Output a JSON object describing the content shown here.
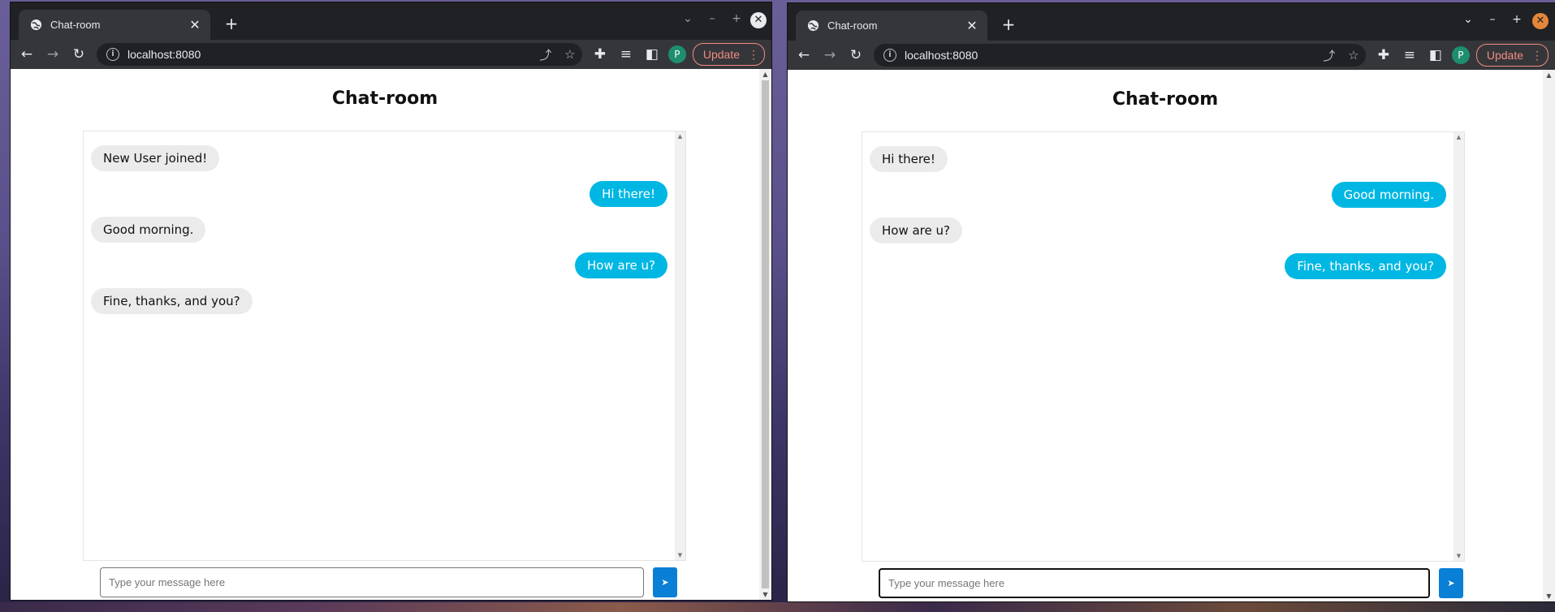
{
  "colors": {
    "sent_bubble": "#00b7e3",
    "received_bubble": "#ebebeb",
    "send_button": "#0a7fd6",
    "update_accent": "#f28b82",
    "profile": "#1e8e6e"
  },
  "icons": [
    "globe-icon",
    "close-icon",
    "plus-icon",
    "chevron-down-icon",
    "back-icon",
    "forward-icon",
    "reload-icon",
    "info-icon",
    "share-icon",
    "star-icon",
    "extensions-icon",
    "media-icon",
    "side-panel-icon",
    "send-icon"
  ],
  "left": {
    "tab_title": "Chat-room",
    "url": "localhost:8080",
    "profile_initial": "P",
    "update_label": "Update",
    "heading": "Chat-room",
    "input_placeholder": "Type your message here",
    "send_glyph": "➤",
    "messages": [
      {
        "direction": "in",
        "text": "New User joined!"
      },
      {
        "direction": "out",
        "text": "Hi there!"
      },
      {
        "direction": "in",
        "text": "Good morning."
      },
      {
        "direction": "out",
        "text": "How are u?"
      },
      {
        "direction": "in",
        "text": "Fine, thanks, and you?"
      }
    ]
  },
  "right": {
    "tab_title": "Chat-room",
    "url": "localhost:8080",
    "profile_initial": "P",
    "update_label": "Update",
    "heading": "Chat-room",
    "input_placeholder": "Type your message here",
    "send_glyph": "➤",
    "messages": [
      {
        "direction": "in",
        "text": "Hi there!"
      },
      {
        "direction": "out",
        "text": "Good morning."
      },
      {
        "direction": "in",
        "text": "How are u?"
      },
      {
        "direction": "out",
        "text": "Fine, thanks, and you?"
      }
    ]
  }
}
